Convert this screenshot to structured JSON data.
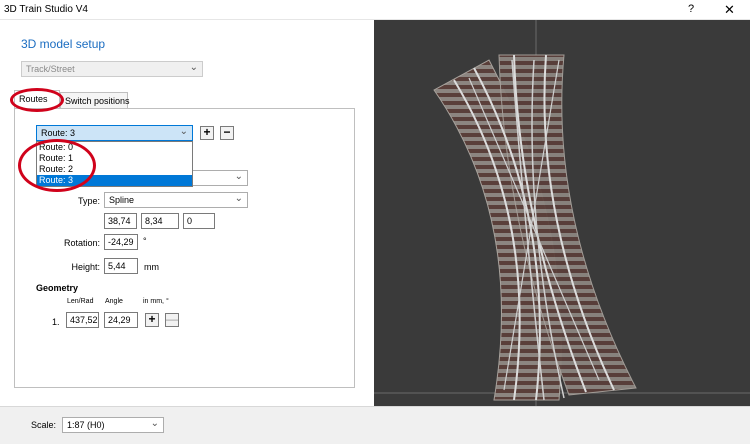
{
  "window": {
    "title": "3D Train Studio V4",
    "help_glyph": "?",
    "close_glyph": "✕"
  },
  "header": {
    "title": "3D model setup"
  },
  "category_select": {
    "value": "Track/Street"
  },
  "tabs": [
    {
      "label": "Routes"
    },
    {
      "label": "Switch positions"
    }
  ],
  "route_select": {
    "value": "Route: 3",
    "options": [
      "Route: 0",
      "Route: 1",
      "Route: 2",
      "Route: 3"
    ],
    "selected_index": 3
  },
  "buttons": {
    "add": "+",
    "remove": "−",
    "geometry_add": "+",
    "geometry_remove": "—"
  },
  "type": {
    "label": "Type:",
    "value": "Spline"
  },
  "position": {
    "x": "38,74",
    "y": "8,34",
    "z": "0"
  },
  "rotation": {
    "label": "Rotation:",
    "value": "-24,29",
    "unit": "°"
  },
  "height": {
    "label": "Height:",
    "value": "5,44",
    "unit": "mm"
  },
  "geometry": {
    "title": "Geometry",
    "col_len": "Len/Rad",
    "col_angle": "Angle",
    "col_units": "in mm, °",
    "rows": [
      {
        "index": "1.",
        "len": "437,52",
        "angle": "24,29"
      }
    ]
  },
  "scale": {
    "label": "Scale:",
    "value": "1:87 (H0)"
  },
  "colors": {
    "viewport_bg": "#3a3a3a",
    "accent": "#1b6dc1",
    "annotation": "#d0021b",
    "selection": "#0078d7"
  }
}
